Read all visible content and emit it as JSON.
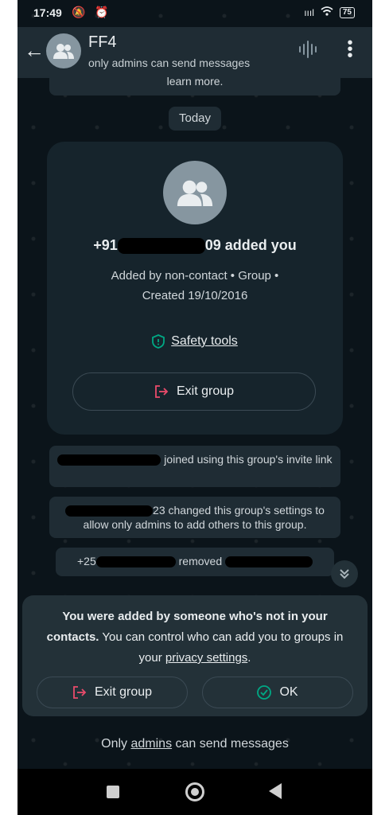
{
  "status_bar": {
    "time": "17:49",
    "battery": "75",
    "left_icons": "🔕 ⏰",
    "signal": "ıııl"
  },
  "header": {
    "title": "FF4",
    "subtitle": "only admins can send messages"
  },
  "chat": {
    "partial_bubble": "learn more.",
    "date_chip": "Today",
    "card": {
      "phone_start": "+91",
      "phone_end": "09",
      "added_suffix": " added you",
      "desc_line1": "Added by non-contact • Group •",
      "desc_line2": "Created 19/10/2016",
      "safety_label": "Safety tools",
      "exit_label": "Exit group"
    },
    "sys1_text": " joined using this group's invite link",
    "sys2_mid": "23 changed this group's settings to allow only admins to add others to this group.",
    "sys3_start": "+25",
    "sys3_mid": " removed "
  },
  "sheet": {
    "line_bold1": "You were added by someone who's not in your contacts.",
    "line_rest": " You can control who can add you to groups in your ",
    "link": "privacy settings",
    "end": ".",
    "exit_label": "Exit group",
    "ok_label": "OK"
  },
  "footer": {
    "prefix": "Only ",
    "link": "admins",
    "suffix": " can send messages"
  },
  "colors": {
    "background": "#0b141a",
    "header": "#1f2c34",
    "accent_green": "#00a884",
    "danger_red": "#ea4b6b"
  }
}
